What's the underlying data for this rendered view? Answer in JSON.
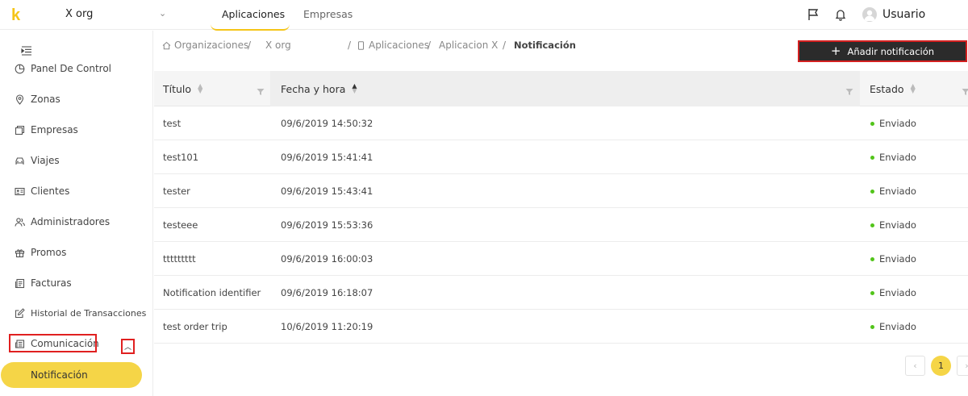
{
  "header": {
    "logo": "k",
    "org_name": "X org",
    "tabs": [
      {
        "label": "Aplicaciones",
        "active": true
      },
      {
        "label": "Empresas",
        "active": false
      }
    ],
    "username": "Usuario"
  },
  "sidebar": {
    "items": [
      {
        "label": "Panel De Control",
        "icon": "pie-chart-icon"
      },
      {
        "label": "Zonas",
        "icon": "location-pin-icon"
      },
      {
        "label": "Empresas",
        "icon": "building-icon"
      },
      {
        "label": "Viajes",
        "icon": "car-icon"
      },
      {
        "label": "Clientes",
        "icon": "id-card-icon"
      },
      {
        "label": "Administradores",
        "icon": "users-icon"
      },
      {
        "label": "Promos",
        "icon": "gift-icon"
      },
      {
        "label": "Facturas",
        "icon": "invoice-icon"
      },
      {
        "label": "Historial de Transacciones",
        "icon": "edit-icon"
      },
      {
        "label": "Comunicación",
        "icon": "newspaper-icon"
      }
    ],
    "sub_item": "Notificación"
  },
  "breadcrumb": {
    "items": [
      "Organizaciones",
      "X org",
      "Aplicaciones",
      "Aplicacion X",
      "Notificación"
    ],
    "separator": "/"
  },
  "actions": {
    "add_label": "Añadir notificación"
  },
  "table": {
    "columns": [
      "Título",
      "Fecha y hora",
      "Estado"
    ],
    "rows": [
      {
        "title": "test",
        "datetime": "09/6/2019 14:50:32",
        "status": "Enviado"
      },
      {
        "title": "test101",
        "datetime": "09/6/2019 15:41:41",
        "status": "Enviado"
      },
      {
        "title": "tester",
        "datetime": "09/6/2019 15:43:41",
        "status": "Enviado"
      },
      {
        "title": "testeee",
        "datetime": "09/6/2019 15:53:36",
        "status": "Enviado"
      },
      {
        "title": "ttttttttt",
        "datetime": "09/6/2019 16:00:03",
        "status": "Enviado"
      },
      {
        "title": "Notification identifier",
        "datetime": "09/6/2019 16:18:07",
        "status": "Enviado"
      },
      {
        "title": "test order trip",
        "datetime": "10/6/2019 11:20:19",
        "status": "Enviado"
      }
    ]
  },
  "pagination": {
    "current_page": "1",
    "prev": "‹",
    "next": "›"
  },
  "colors": {
    "accent": "#f5c518",
    "highlight": "#e02020",
    "status_sent": "#52c41a"
  }
}
